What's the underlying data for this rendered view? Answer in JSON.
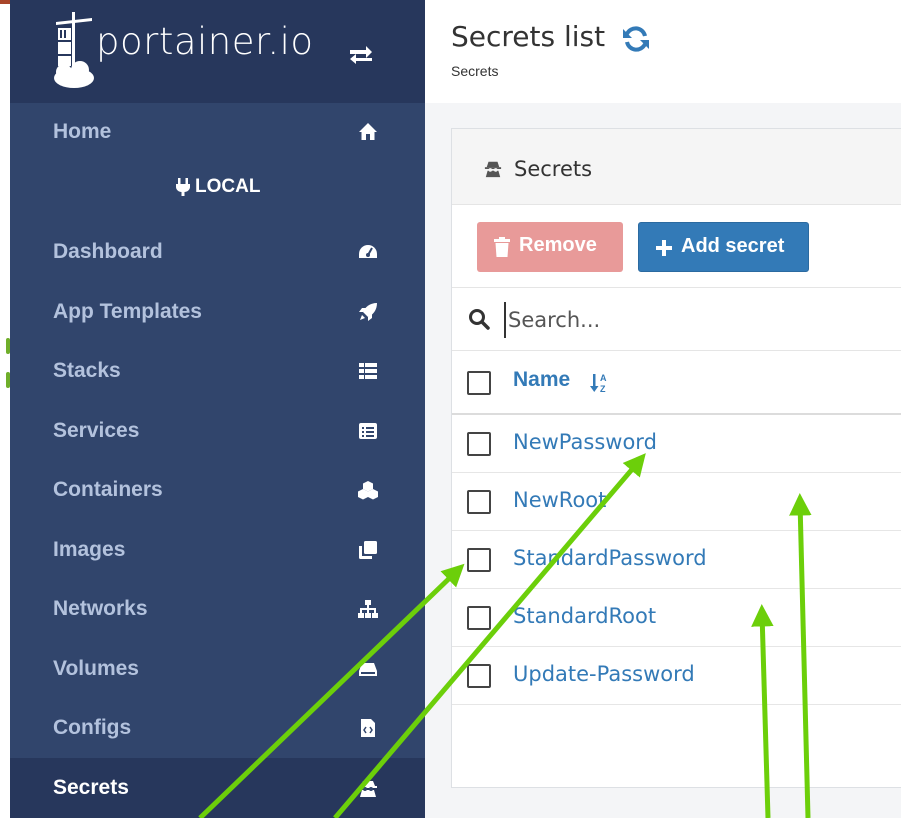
{
  "brand": {
    "name": "portainer.io"
  },
  "sidebar": {
    "items_top": [
      {
        "label": "Home",
        "icon": "home-icon"
      }
    ],
    "endpoint": {
      "label": "LOCAL",
      "icon": "plug-icon"
    },
    "items": [
      {
        "label": "Dashboard",
        "icon": "tachometer-icon"
      },
      {
        "label": "App Templates",
        "icon": "rocket-icon"
      },
      {
        "label": "Stacks",
        "icon": "th-list-icon"
      },
      {
        "label": "Services",
        "icon": "list-alt-icon"
      },
      {
        "label": "Containers",
        "icon": "cubes-icon"
      },
      {
        "label": "Images",
        "icon": "clone-icon"
      },
      {
        "label": "Networks",
        "icon": "sitemap-icon"
      },
      {
        "label": "Volumes",
        "icon": "hdd-icon"
      },
      {
        "label": "Configs",
        "icon": "file-code-icon"
      },
      {
        "label": "Secrets",
        "icon": "user-secret-icon",
        "active": true
      }
    ]
  },
  "header": {
    "title": "Secrets list",
    "breadcrumb": "Secrets"
  },
  "widget": {
    "title": "Secrets",
    "remove_label": "Remove",
    "add_label": "Add secret",
    "search_placeholder": "Search...",
    "column_name": "Name",
    "rows": [
      {
        "name": "NewPassword"
      },
      {
        "name": "NewRoot"
      },
      {
        "name": "StandardPassword"
      },
      {
        "name": "StandardRoot"
      },
      {
        "name": "Update-Password"
      }
    ]
  },
  "colors": {
    "sidebar_bg": "#31456c",
    "sidebar_dark": "#27375c",
    "link_blue": "#337ab7",
    "remove_red": "#e89a99",
    "annotation_green": "#6ccf0a"
  }
}
